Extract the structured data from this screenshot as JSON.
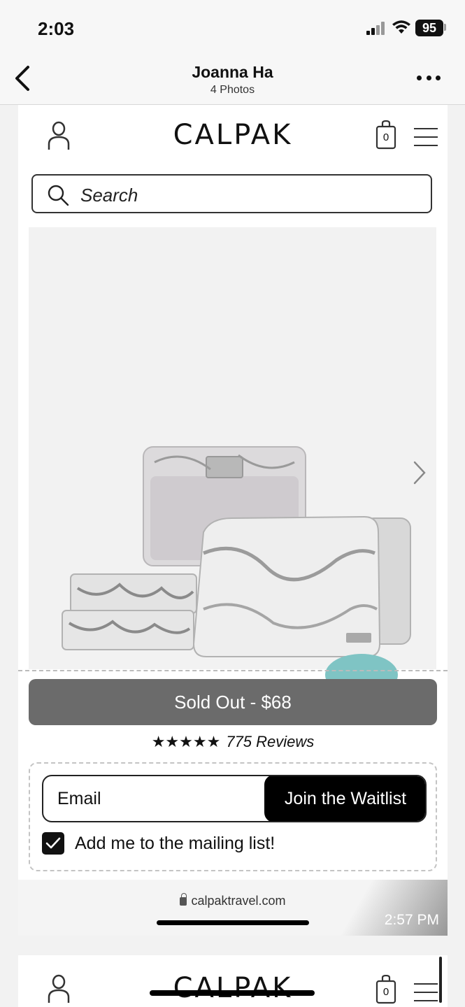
{
  "status_bar": {
    "time": "2:03",
    "battery": "95"
  },
  "nav": {
    "title": "Joanna Ha",
    "subtitle": "4 Photos"
  },
  "site": {
    "brand": "CALPAK",
    "cart_count": "0",
    "search_placeholder": "Search",
    "product": {
      "sold_label": "Sold Out - $68",
      "stars": "★★★★★",
      "reviews": "775 Reviews"
    },
    "waitlist": {
      "email_label": "Email",
      "join_label": "Join the Waitlist",
      "mailing_label": "Add me to the mailing list!",
      "mailing_checked": true
    },
    "browser": {
      "url": "calpaktravel.com",
      "timestamp": "2:57 PM"
    }
  },
  "next_card": {
    "brand": "CALPAK",
    "cart_count": "0"
  }
}
